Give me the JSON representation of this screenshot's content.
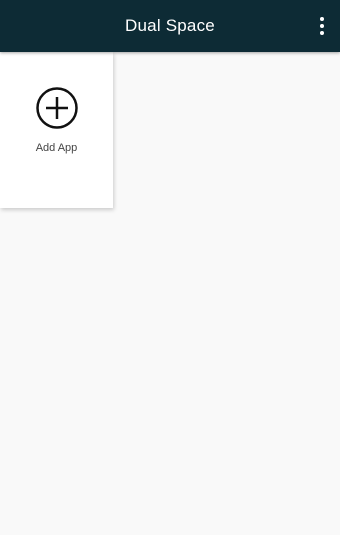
{
  "app_bar": {
    "title": "Dual Space",
    "menu_icon": "more-vert-icon",
    "background_color": "#0d2b35"
  },
  "grid": {
    "tiles": [
      {
        "label": "Add App",
        "icon": "add-circle-icon"
      }
    ]
  }
}
